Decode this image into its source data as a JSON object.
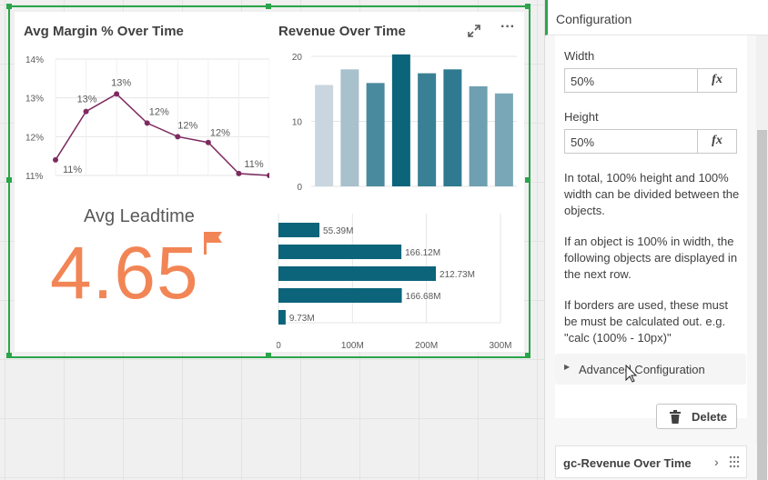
{
  "dashboard": {
    "margin_chart": {
      "title": "Avg Margin % Over Time",
      "y_ticks": [
        "14%",
        "13%",
        "12%",
        "11%"
      ],
      "point_labels": [
        "11%",
        "13%",
        "13%",
        "12%",
        "12%",
        "12%",
        "11%"
      ]
    },
    "revenue_chart": {
      "title": "Revenue Over Time",
      "y_ticks": [
        "20",
        "10",
        "0"
      ]
    },
    "kpi": {
      "title": "Avg Leadtime",
      "value": "4.65",
      "color": "#f28555"
    },
    "bar_chart": {
      "labels": [
        "55.39M",
        "166.12M",
        "212.73M",
        "166.68M",
        "9.73M"
      ],
      "x_ticks": [
        "0",
        "100M",
        "200M",
        "300M"
      ]
    }
  },
  "chart_data": [
    {
      "type": "line",
      "title": "Avg Margin % Over Time",
      "y": [
        11.4,
        12.65,
        13.1,
        12.35,
        12.0,
        11.85,
        11.05,
        11.0
      ],
      "data_labels": [
        "11%",
        "13%",
        "13%",
        "12%",
        "12%",
        "12%",
        "11%"
      ],
      "ylim": [
        11,
        14
      ],
      "grid": true,
      "color": "#7d2a5f"
    },
    {
      "type": "bar",
      "title": "Revenue Over Time",
      "values": [
        15.6,
        18.0,
        15.9,
        20.3,
        17.4,
        18.0,
        15.4,
        14.3
      ],
      "colors": [
        "#c9d6e0",
        "#a9c0cd",
        "#4a8a9e",
        "#0b647a",
        "#3a8094",
        "#2f7a90",
        "#6fa0b1",
        "#7aa7b7"
      ],
      "ylim": [
        0,
        20
      ],
      "grid": true
    },
    {
      "type": "bar",
      "orientation": "horizontal",
      "values": [
        55.39,
        166.12,
        212.73,
        166.68,
        9.73
      ],
      "data_labels": [
        "55.39M",
        "166.12M",
        "212.73M",
        "166.68M",
        "9.73M"
      ],
      "xlim": [
        0,
        300
      ],
      "x_ticks": [
        "0",
        "100M",
        "200M",
        "300M"
      ],
      "color": "#0b647a"
    }
  ],
  "panel": {
    "header": "Configuration",
    "width_label": "Width",
    "width_value": "50%",
    "height_label": "Height",
    "height_value": "50%",
    "fx_label": "fx",
    "help_1": "In total, 100% height and 100% width can be divided between the objects.",
    "help_2": "If an object is 100% in width, the following objects are displayed in the next row.",
    "help_3": "If borders are used, these must be must be calculated out. e.g. \"calc (100% - 10px)\"",
    "advanced_label": "Advanced Configuration",
    "delete_label": "Delete",
    "next_item_label": "gc-Revenue Over Time"
  },
  "icons": {
    "expand": "expand-icon",
    "more": "more-icon",
    "flag": "flag-icon",
    "trash": "trash-icon",
    "chevron": "chevron-right-icon",
    "grip": "drag-grip-icon",
    "cursor": "mouse-cursor-icon"
  }
}
